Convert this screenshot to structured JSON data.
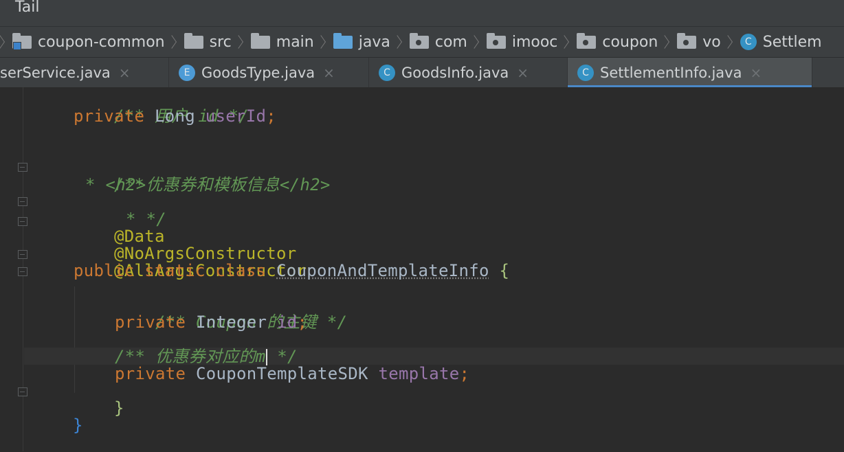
{
  "menu": {
    "tail_label": "Tail"
  },
  "breadcrumb": [
    {
      "label": "coupon-common",
      "icon": "module-folder-icon"
    },
    {
      "label": "src",
      "icon": "folder-icon"
    },
    {
      "label": "main",
      "icon": "folder-icon"
    },
    {
      "label": "java",
      "icon": "source-folder-icon"
    },
    {
      "label": "com",
      "icon": "package-icon"
    },
    {
      "label": "imooc",
      "icon": "package-icon"
    },
    {
      "label": "coupon",
      "icon": "package-icon"
    },
    {
      "label": "vo",
      "icon": "package-icon"
    },
    {
      "label": "Settlem",
      "icon": "class-icon"
    }
  ],
  "tabs": [
    {
      "label": "serService.java",
      "close": "×"
    },
    {
      "label": "GoodsType.java",
      "icon_letter": "E",
      "close": "×"
    },
    {
      "label": "GoodsInfo.java",
      "icon_letter": "C",
      "close": "×"
    },
    {
      "label": "SettlementInfo.java",
      "icon_letter": "C",
      "close": "×",
      "active": true
    }
  ],
  "code": {
    "l1": "/** 用户 id */",
    "l2_kw": "private",
    "l2_type": "Long",
    "l2_field": "userId",
    "l2_semi": ";",
    "l4": "/**",
    "l5_star": "* ",
    "l5_open": "<h2>",
    "l5_text": "优惠券和模板信息",
    "l5_close": "</h2>",
    "l6": "* */",
    "l7": "@Data",
    "l8": "@NoArgsConstructor",
    "l9": "@AllArgsConstructor",
    "l10_kw": "public static class",
    "l10_name": "CouponAndTemplateInfo",
    "l10_brace": "{",
    "l12": "/** Coupon 的主键 */",
    "l13_kw": "private",
    "l13_type": "Integer",
    "l13_field": "id",
    "l13_semi": ";",
    "l15_pre": "/** 优惠券对应的m",
    "l15_post": " */",
    "l16_kw": "private",
    "l16_type": "CouponTemplateSDK",
    "l16_field": "template",
    "l16_semi": ";",
    "l17": "}",
    "l18": "}"
  }
}
